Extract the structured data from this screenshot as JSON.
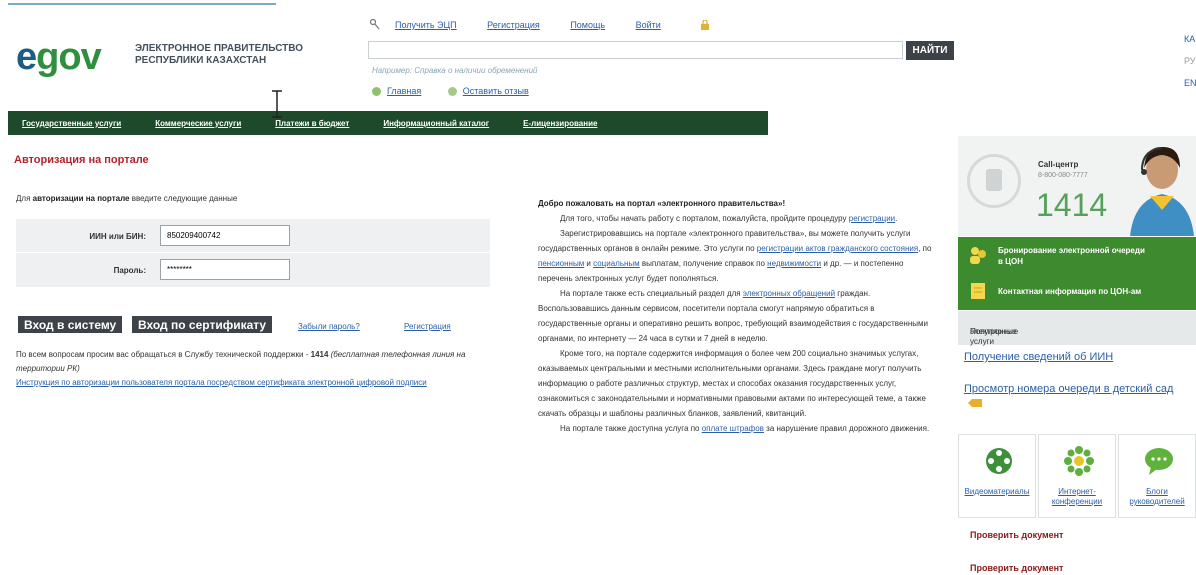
{
  "header": {
    "logo_e": "e",
    "logo_gov": "gov",
    "logo_line1": "ЭЛЕКТРОННОЕ ПРАВИТЕЛЬСТВО",
    "logo_line2": "РЕСПУБЛИКИ КАЗАХСТАН",
    "links": [
      "Получить ЭЦП",
      "Регистрация",
      "Помощь",
      "Войти"
    ],
    "search_button": "НАЙТИ",
    "search_hint": "Например: Справка о наличии обременений",
    "sub_links": [
      "Главная",
      "Оставить отзыв"
    ],
    "right_edge": [
      "КА",
      "РУ",
      "EN"
    ]
  },
  "nav": {
    "items": [
      "Государственные услуги",
      "Коммерческие услуги",
      "Платежи в бюджет",
      "Информационный каталог",
      "Е-лицензирование"
    ]
  },
  "auth": {
    "title": "Авторизация на портале",
    "intro_pre": "Для ",
    "intro_bold": "авторизации на портале",
    "intro_post": " введите следующие данные",
    "iin_label": "ИИН или БИН:",
    "iin_value": "850209400742",
    "password_label": "Пароль:",
    "password_value": "********",
    "login_button": "Вход в систему",
    "cert_button": "Вход по сертификату",
    "forgot_link": "Забыли пароль?",
    "register_link": "Регистрация",
    "support_pre": "По всем вопросам просим вас обращаться в Службу технической поддержки - ",
    "support_num": "1414",
    "support_italic": " (бесплатная телефонная линия на территории РК)",
    "instruction_link": "Инструкция по авторизации пользователя портала посредством сертификата электронной цифровой подписи"
  },
  "welcome": {
    "title": "Добро пожаловать на портал «электронного правительства»!",
    "p1_text": "Для того, чтобы начать работу с порталом, пожалуйста, пройдите процедуру ",
    "p1_link": "регистрации",
    "p1_end": ".",
    "p2_a": "Зарегистрировавшись на портале «электронного правительства», вы можете получить услуги государственных органов в онлайн режиме. Это услуги по ",
    "p2_link1": "регистрации актов гражданского состояния",
    "p2_b": ", по ",
    "p2_link2": "пенсионным",
    "p2_c": " и ",
    "p2_link3": "социальным",
    "p2_d": " выплатам, получение справок по ",
    "p2_link4": "недвижимости",
    "p2_e": " и др. — и постепенно перечень электронных услуг будет пополняться.",
    "p3_a": "На портале также есть специальный раздел для ",
    "p3_link": "электронных обращений",
    "p3_b": " граждан. Воспользовавшись данным сервисом, посетители портала смогут напрямую обратиться в государственные органы и оперативно решить вопрос, требующий взаимодействия с государственными органами, по интернету — 24 часа в сутки и 7 дней в неделю.",
    "p4": "Кроме того, на портале содержится информация о более чем 200 социально значимых услугах, оказываемых центральными и местными исполнительными органами. Здесь граждане могут получить информацию о работе различных структур, местах и способах оказания государственных услуг, ознакомиться с законодательными и нормативными правовыми актами по интересующей теме, а также скачать образцы и шаблоны различных бланков, заявлений, квитанций.",
    "p5_a": "На портале также доступна услуга по ",
    "p5_link": "оплате штрафов",
    "p5_b": " за нарушение правил дорожного движения."
  },
  "sidebar": {
    "callcenter_title": "Call-центр",
    "callcenter_number": "8-800-080-7777",
    "callcenter_short": "1414",
    "green1_line1": "Бронирование электронной очереди",
    "green1_line2": "в ЦОН",
    "green2": "Контактная информация по ЦОН-ам",
    "popular_line1": "Популярные",
    "popular_line2": "электронные услуги",
    "pop_link1": "Получение сведений об ИИН",
    "pop_link2": "Просмотр номера очереди в детский сад",
    "tiles": [
      {
        "label": "Видеоматериалы"
      },
      {
        "label": "Интернет-конференции"
      },
      {
        "label": "Блоги руководителей"
      }
    ],
    "check1": "Проверить документ",
    "check2": "Проверить документ"
  },
  "colors": {
    "nav_bg": "#1e4a2b",
    "accent_red": "#b3232e",
    "green": "#3d8a2f",
    "link": "#2a5fa8"
  }
}
